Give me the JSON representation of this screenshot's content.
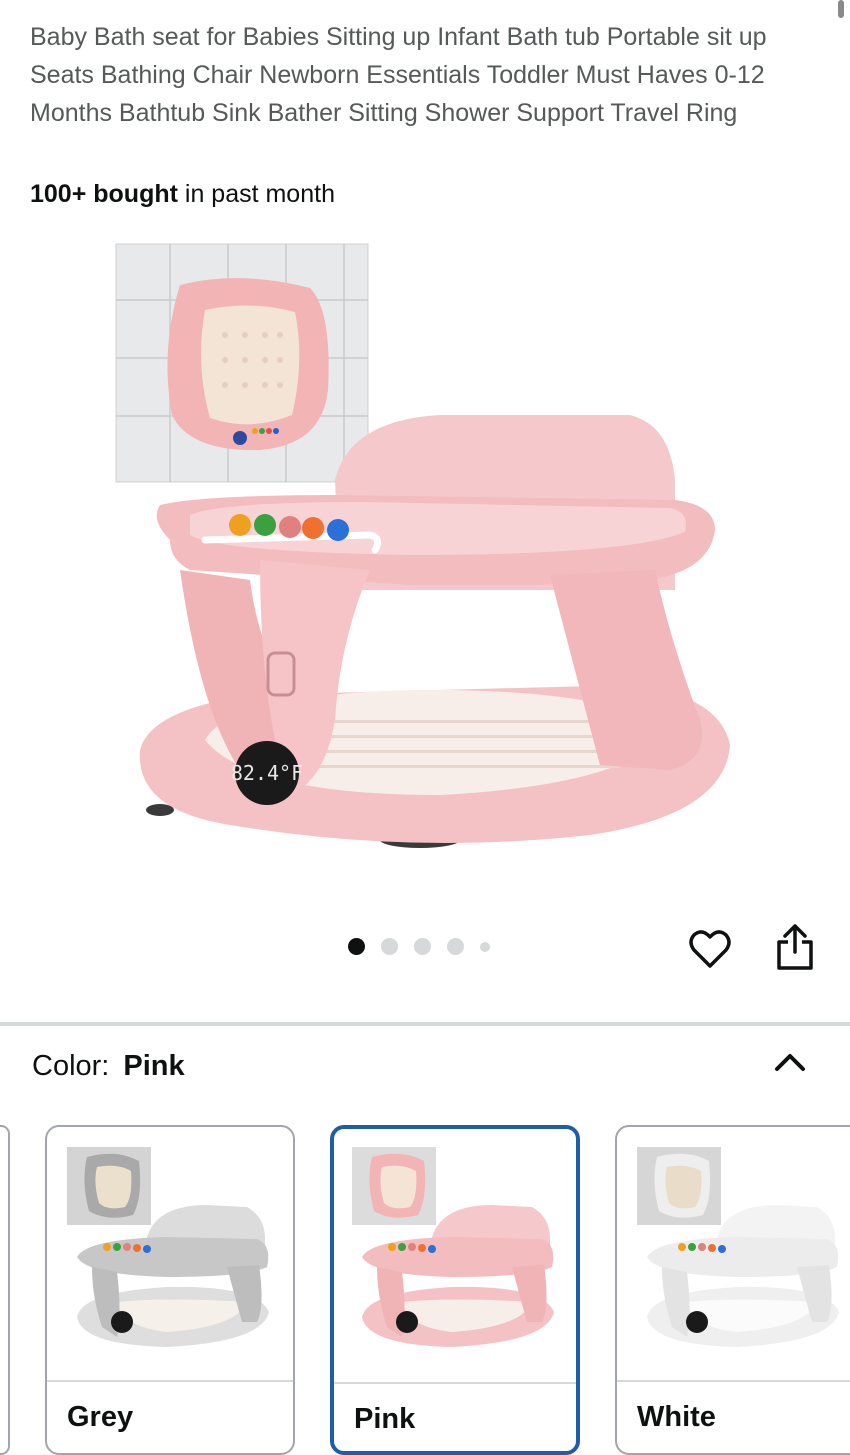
{
  "product": {
    "title": "Baby Bath seat for Babies Sitting up Infant Bath tub Portable sit up Seats Bathing Chair Newborn Essentials Toddler Must Haves 0-12 Months Bathtub Sink Bather Sitting Shower Support Travel Ring",
    "bought_bold": "100+ bought",
    "bought_rest": " in past month"
  },
  "gallery": {
    "thermometer_reading": "82.4°F",
    "total_images": 5,
    "active_index": 0
  },
  "actions": {
    "favorite_icon": "heart-icon",
    "share_icon": "share-icon"
  },
  "color_selector": {
    "label": "Color:",
    "selected": "Pink",
    "toggle_icon": "chevron-up-icon",
    "options": [
      {
        "name": "Grey",
        "color": "#c9c9c9"
      },
      {
        "name": "Pink",
        "color": "#f5c6c8"
      },
      {
        "name": "White",
        "color": "#f1f1f1"
      }
    ]
  },
  "colors": {
    "title_text": "#565959",
    "selected_border": "#1f5da8",
    "seat_pink": "#f4c2c4"
  }
}
